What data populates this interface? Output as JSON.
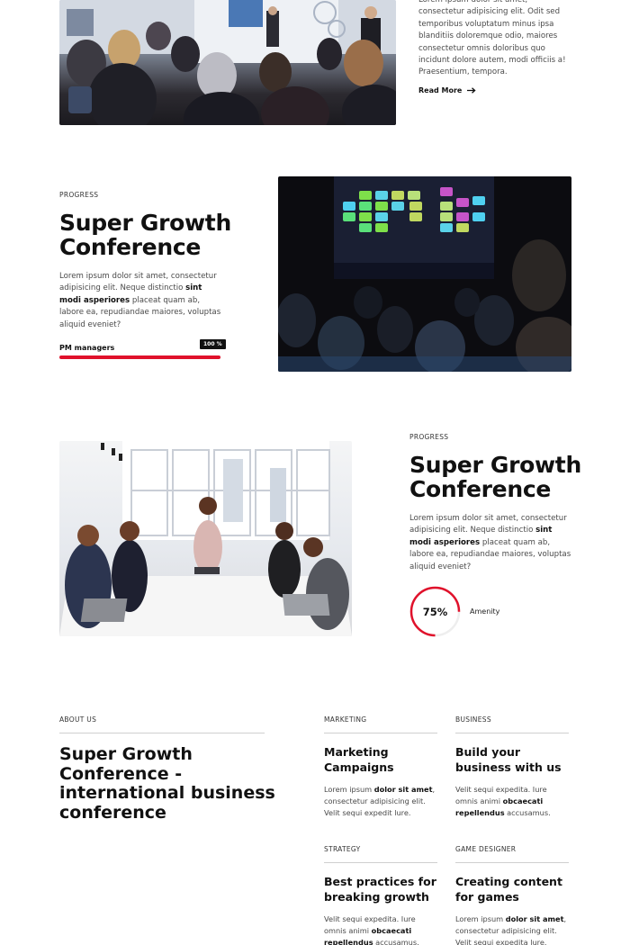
{
  "section1": {
    "text": "Lorem ipsum dolor sit amet, consectetur adipisicing elit. Odit sed temporibus voluptatum minus ipsa blanditiis doloremque odio, maiores consectetur omnis doloribus quo incidunt dolore autem, modi officiis a! Praesentium, tempora.",
    "read_more": "Read More"
  },
  "section2": {
    "label": "PROGRESS",
    "title": "Super Growth Conference",
    "body_pre": "Lorem ipsum dolor sit amet, consectetur adipisicing elit. Neque distinctio ",
    "body_bold": "sint modi asperiores",
    "body_post": " placeat quam ab, labore ea, repudiandae maiores, voluptas aliquid eveniet?",
    "bar_label": "PM managers",
    "bar_value": "100 %",
    "bar_fraction": 1.0,
    "accent": "#e0112b"
  },
  "section3": {
    "label": "PROGRESS",
    "title": "Super Growth Conference",
    "body_pre": "Lorem ipsum dolor sit amet, consectetur adipisicing elit. Neque distinctio ",
    "body_bold": "sint modi asperiores",
    "body_post": " placeat quam ab, labore ea, repudiandae maiores, voluptas aliquid eveniet?",
    "ring_value": "75%",
    "ring_fraction": 0.75,
    "ring_label": "Amenity"
  },
  "section4": {
    "about_label": "ABOUT US",
    "about_title": "Super Growth Conference - international business conference",
    "cards": [
      {
        "label": "MARKETING",
        "title": "Marketing Campaigns",
        "body_pre": "Lorem ipsum ",
        "body_bold": "dolor sit amet",
        "body_post": ", consectetur adipisicing elit. Velit sequi expedit lure."
      },
      {
        "label": "BUSINESS",
        "title": "Build your business with us",
        "body_pre": "Velit sequi expedita. Iure omnis animi ",
        "body_bold": "obcaecati repellendus",
        "body_post": " accusamus."
      },
      {
        "label": "STRATEGY",
        "title": "Best practices for breaking growth",
        "body_pre": "Velit sequi expedita. Iure omnis animi ",
        "body_bold": "obcaecati repellendus",
        "body_post": " accusamus."
      },
      {
        "label": "GAME DESIGNER",
        "title": "Creating content for games",
        "body_pre": "Lorem ipsum ",
        "body_bold": "dolor sit amet",
        "body_post": ", consectetur adipisicing elit. Velit sequi expedita lure."
      }
    ]
  }
}
